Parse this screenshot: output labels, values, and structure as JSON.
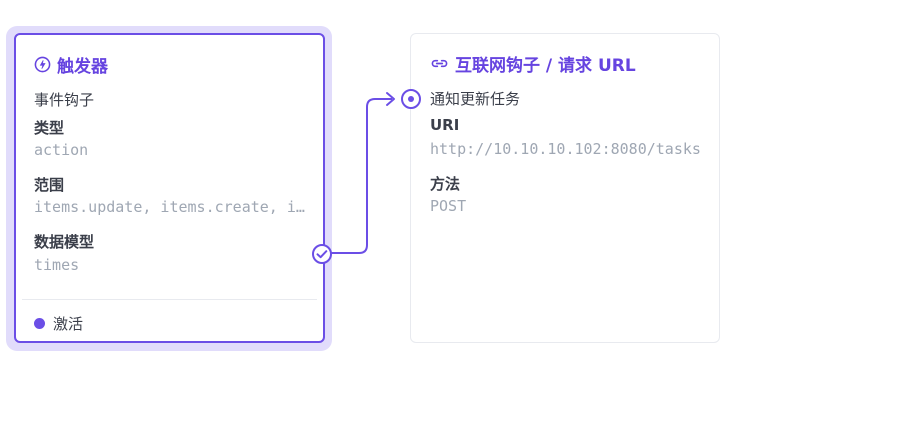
{
  "trigger": {
    "title": "触发器",
    "subtitle": "事件钩子",
    "fields": [
      {
        "label": "类型",
        "value": "action"
      },
      {
        "label": "范围",
        "value": "items.update, items.create, items.delete"
      },
      {
        "label": "数据模型",
        "value": "times"
      }
    ],
    "status": "激活"
  },
  "operation": {
    "title": "互联网钩子 / 请求 URL",
    "subtitle": "通知更新任务",
    "fields": [
      {
        "label": "URI",
        "value": "http://10.10.10.102:8080/tasks"
      },
      {
        "label": "方法",
        "value": "POST"
      }
    ]
  },
  "colors": {
    "accent": "#6b4ee6",
    "glow": "#e1dcfb",
    "muted": "#9fa7b3"
  },
  "icons": {
    "trigger": "bolt-icon",
    "operation": "link-icon",
    "resolve": "check-circle-icon",
    "input": "target-icon"
  }
}
